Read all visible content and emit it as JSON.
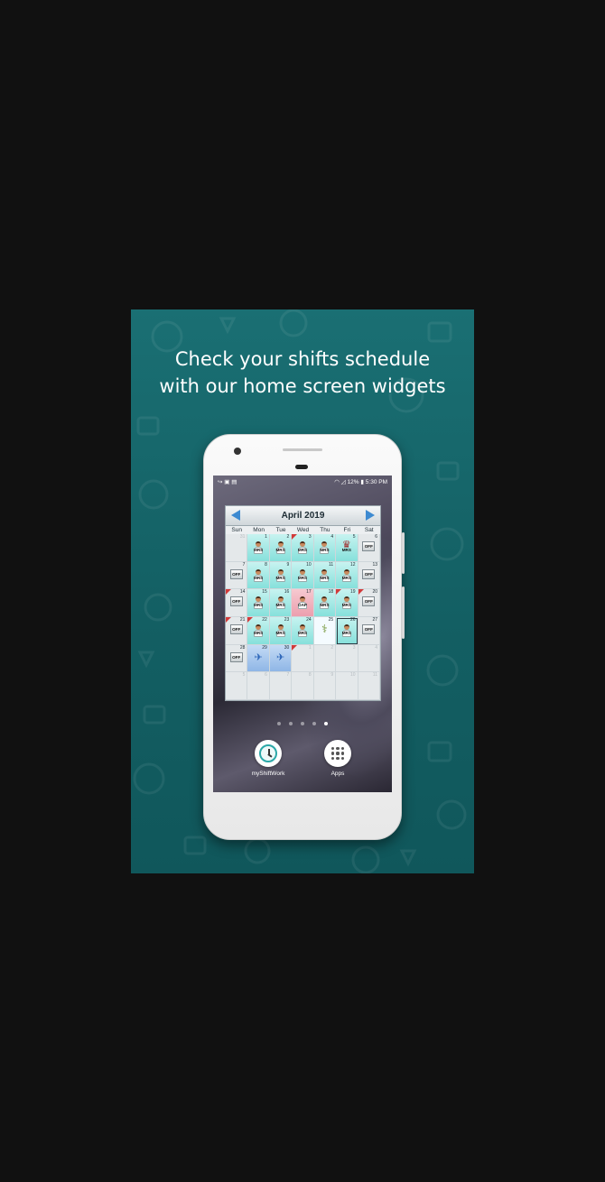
{
  "promo": {
    "headline_line1": "Check your shifts schedule",
    "headline_line2": "with our home screen widgets",
    "background_color": "#156569"
  },
  "status_bar": {
    "left_icons": [
      "call-forward-icon",
      "image-icon",
      "clipboard-icon"
    ],
    "battery": "12%",
    "time": "5:30 PM"
  },
  "widget": {
    "month_title": "April 2019",
    "weekdays": [
      "Sun",
      "Mon",
      "Tue",
      "Wed",
      "Thu",
      "Fri",
      "Sat"
    ],
    "weeks": [
      [
        {
          "day": "31",
          "type": "",
          "other": true,
          "flag": false
        },
        {
          "day": "1",
          "type": "MRS",
          "other": false,
          "flag": false
        },
        {
          "day": "2",
          "type": "MRS",
          "other": false,
          "flag": false
        },
        {
          "day": "3",
          "type": "MRS",
          "other": false,
          "flag": true
        },
        {
          "day": "4",
          "type": "MRS",
          "other": false,
          "flag": false
        },
        {
          "day": "5",
          "type": "MRS",
          "icon": "crown",
          "other": false,
          "flag": false
        },
        {
          "day": "6",
          "type": "OFF",
          "other": false,
          "flag": false
        }
      ],
      [
        {
          "day": "7",
          "type": "OFF",
          "other": false,
          "flag": false
        },
        {
          "day": "8",
          "type": "MRS",
          "other": false,
          "flag": false
        },
        {
          "day": "9",
          "type": "MRS",
          "other": false,
          "flag": false
        },
        {
          "day": "10",
          "type": "MRS",
          "other": false,
          "flag": false
        },
        {
          "day": "11",
          "type": "MRS",
          "other": false,
          "flag": false
        },
        {
          "day": "12",
          "type": "MRS",
          "other": false,
          "flag": false
        },
        {
          "day": "13",
          "type": "OFF",
          "other": false,
          "flag": false
        }
      ],
      [
        {
          "day": "14",
          "type": "OFF",
          "other": false,
          "flag": true
        },
        {
          "day": "15",
          "type": "MRS",
          "other": false,
          "flag": false
        },
        {
          "day": "16",
          "type": "MRS",
          "other": false,
          "flag": false
        },
        {
          "day": "17",
          "type": "OAP",
          "other": false,
          "flag": false
        },
        {
          "day": "18",
          "type": "MRS",
          "other": false,
          "flag": false
        },
        {
          "day": "19",
          "type": "MRS",
          "other": false,
          "flag": true
        },
        {
          "day": "20",
          "type": "OFF",
          "other": false,
          "flag": true
        }
      ],
      [
        {
          "day": "21",
          "type": "OFF",
          "other": false,
          "flag": true
        },
        {
          "day": "22",
          "type": "MRS",
          "other": false,
          "flag": true
        },
        {
          "day": "23",
          "type": "MRS",
          "other": false,
          "flag": false
        },
        {
          "day": "24",
          "type": "MRS",
          "other": false,
          "flag": false
        },
        {
          "day": "25",
          "type": "MED",
          "other": false,
          "flag": false
        },
        {
          "day": "26",
          "type": "MRS",
          "other": false,
          "flag": false,
          "today": true
        },
        {
          "day": "27",
          "type": "OFF",
          "other": false,
          "flag": false
        }
      ],
      [
        {
          "day": "28",
          "type": "OFF",
          "other": false,
          "flag": false
        },
        {
          "day": "29",
          "type": "TRIP",
          "other": false,
          "flag": false
        },
        {
          "day": "30",
          "type": "TRIP",
          "other": false,
          "flag": false
        },
        {
          "day": "1",
          "type": "",
          "other": true,
          "flag": true
        },
        {
          "day": "2",
          "type": "",
          "other": true,
          "flag": false
        },
        {
          "day": "3",
          "type": "",
          "other": true,
          "flag": false
        },
        {
          "day": "4",
          "type": "",
          "other": true,
          "flag": false
        }
      ],
      [
        {
          "day": "5",
          "type": "",
          "other": true,
          "flag": false
        },
        {
          "day": "6",
          "type": "",
          "other": true,
          "flag": false
        },
        {
          "day": "7",
          "type": "",
          "other": true,
          "flag": false
        },
        {
          "day": "8",
          "type": "",
          "other": true,
          "flag": false
        },
        {
          "day": "9",
          "type": "",
          "other": true,
          "flag": false
        },
        {
          "day": "10",
          "type": "",
          "other": true,
          "flag": false
        },
        {
          "day": "11",
          "type": "",
          "other": true,
          "flag": false
        }
      ]
    ]
  },
  "home": {
    "page_dots": 5,
    "active_dot": 5,
    "apps": [
      {
        "label": "myShiftWork",
        "icon": "clock-icon"
      },
      {
        "label": "Apps",
        "icon": "app-drawer-icon"
      }
    ]
  }
}
